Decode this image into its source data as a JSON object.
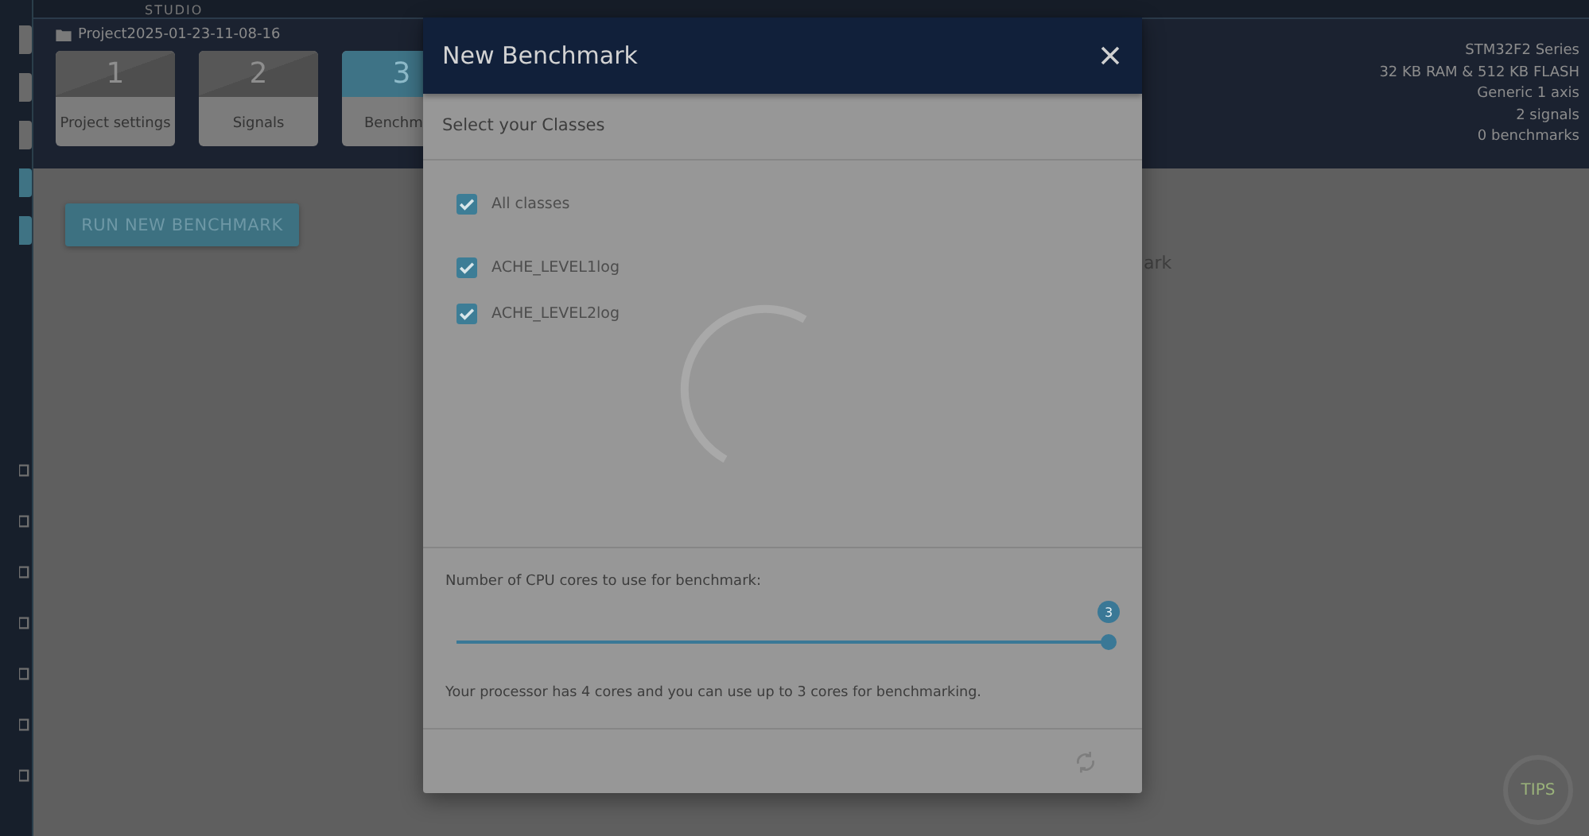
{
  "top_bar": {
    "title": "STUDIO"
  },
  "project": {
    "name": "Project2025-01-23-11-08-16"
  },
  "steps": [
    {
      "number": "1",
      "label": "Project settings",
      "selected": false
    },
    {
      "number": "2",
      "label": "Signals",
      "selected": false
    },
    {
      "number": "3",
      "label": "Benchm",
      "selected": true
    }
  ],
  "info": [
    "STM32F2 Series",
    "32 KB RAM & 512 KB FLASH",
    "Generic 1 axis",
    "2 signals",
    "0 benchmarks"
  ],
  "run_button": "RUN NEW BENCHMARK",
  "covered_text": "ark",
  "tips_button": "TIPS",
  "modal": {
    "title": "New Benchmark",
    "section_title": "Select your Classes",
    "all_classes": {
      "label": "All classes",
      "checked": true
    },
    "classes": [
      {
        "label": "ACHE_LEVEL1log",
        "checked": true
      },
      {
        "label": "ACHE_LEVEL2log",
        "checked": true
      }
    ],
    "slider": {
      "label": "Number of CPU cores to use for benchmark:",
      "value": "3",
      "level": 1
    },
    "note": "Your processor has 4 cores and you can use up to 3 cores for benchmarking."
  }
}
